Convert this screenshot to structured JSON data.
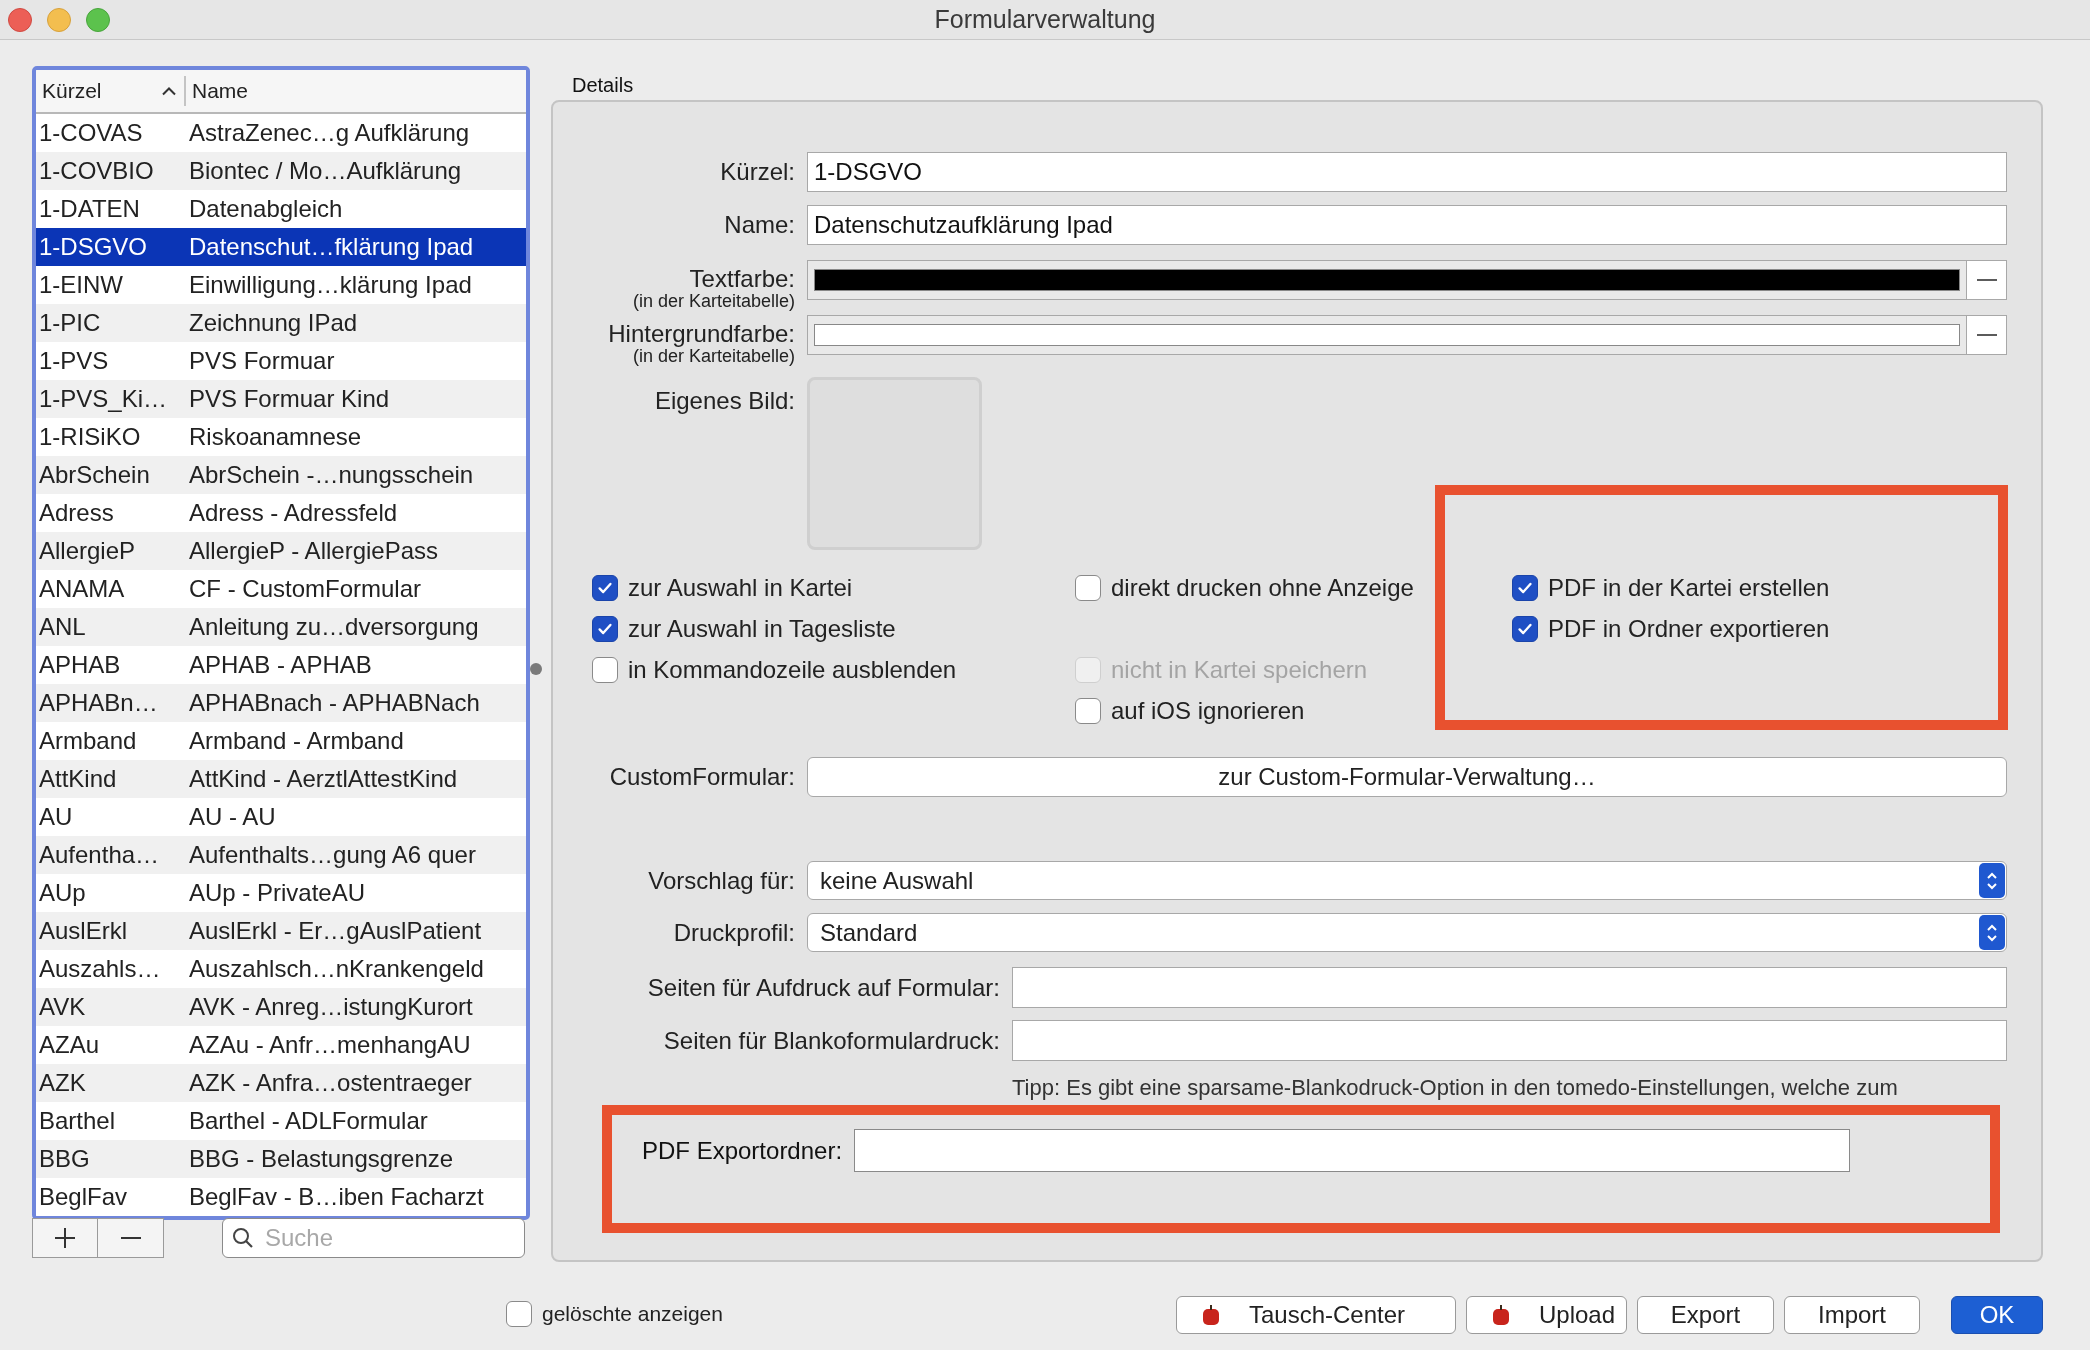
{
  "window": {
    "title": "Formularverwaltung"
  },
  "list": {
    "columns": [
      {
        "label": "Kürzel",
        "sorted": true
      },
      {
        "label": "Name",
        "sorted": false
      }
    ],
    "rows": [
      {
        "kuerzel": "1-COVAS",
        "name": "AstraZenec…g Aufklärung",
        "selected": false
      },
      {
        "kuerzel": "1-COVBIO",
        "name": "Biontec / Mo…Aufklärung",
        "selected": false
      },
      {
        "kuerzel": "1-DATEN",
        "name": "Datenabgleich",
        "selected": false
      },
      {
        "kuerzel": "1-DSGVO",
        "name": "Datenschut…fklärung Ipad",
        "selected": true
      },
      {
        "kuerzel": "1-EINW",
        "name": "Einwilligung…klärung  Ipad",
        "selected": false
      },
      {
        "kuerzel": "1-PIC",
        "name": "Zeichnung IPad",
        "selected": false
      },
      {
        "kuerzel": "1-PVS",
        "name": "PVS Formuar",
        "selected": false
      },
      {
        "kuerzel": "1-PVS_Ki…",
        "name": "PVS Formuar Kind",
        "selected": false
      },
      {
        "kuerzel": "1-RISiKO",
        "name": "Riskoanamnese",
        "selected": false
      },
      {
        "kuerzel": "AbrSchein",
        "name": "AbrSchein -…nungsschein",
        "selected": false
      },
      {
        "kuerzel": "Adress",
        "name": "Adress - Adressfeld",
        "selected": false
      },
      {
        "kuerzel": "AllergieP",
        "name": "AllergieP - AllergiePass",
        "selected": false
      },
      {
        "kuerzel": "ANAMA",
        "name": "CF - CustomFormular",
        "selected": false
      },
      {
        "kuerzel": "ANL",
        "name": "Anleitung zu…dversorgung",
        "selected": false
      },
      {
        "kuerzel": "APHAB",
        "name": "APHAB - APHAB",
        "selected": false
      },
      {
        "kuerzel": "APHABn…",
        "name": "APHABnach - APHABNach",
        "selected": false
      },
      {
        "kuerzel": "Armband",
        "name": "Armband - Armband",
        "selected": false
      },
      {
        "kuerzel": "AttKind",
        "name": "AttKind - AerztlAttestKind",
        "selected": false
      },
      {
        "kuerzel": "AU",
        "name": "AU - AU",
        "selected": false
      },
      {
        "kuerzel": "Aufentha…",
        "name": "Aufenthalts…gung A6 quer",
        "selected": false
      },
      {
        "kuerzel": "AUp",
        "name": "AUp - PrivateAU",
        "selected": false
      },
      {
        "kuerzel": "AuslErkl",
        "name": "AuslErkl - Er…gAuslPatient",
        "selected": false
      },
      {
        "kuerzel": "Auszahls…",
        "name": "Auszahlsch…nKrankengeld",
        "selected": false
      },
      {
        "kuerzel": "AVK",
        "name": "AVK - Anreg…istungKurort",
        "selected": false
      },
      {
        "kuerzel": "AZAu",
        "name": "AZAu - Anfr…menhangAU",
        "selected": false
      },
      {
        "kuerzel": "AZK",
        "name": "AZK - Anfra…ostentraeger",
        "selected": false
      },
      {
        "kuerzel": "Barthel",
        "name": "Barthel - ADLFormular",
        "selected": false
      },
      {
        "kuerzel": "BBG",
        "name": "BBG - Belastungsgrenze",
        "selected": false
      },
      {
        "kuerzel": "BeglFav",
        "name": "BeglFav - B…iben Facharzt",
        "selected": false
      }
    ]
  },
  "search": {
    "placeholder": "Suche"
  },
  "details": {
    "title": "Details",
    "fields": [
      {
        "label": "Kürzel:",
        "value": "1-DSGVO"
      },
      {
        "label": "Name:",
        "value": "Datenschutzaufklärung Ipad"
      }
    ],
    "colors": [
      {
        "label": "Textfarbe:",
        "sublabel": "(in der Karteitabelle)",
        "color": "#000000"
      },
      {
        "label": "Hintergrundfarbe:",
        "sublabel": "(in der Karteitabelle)",
        "color": "#ffffff"
      }
    ],
    "image_label": "Eigenes Bild:",
    "option_columns": [
      {
        "options": [
          {
            "label": "zur Auswahl in Kartei",
            "checked": true,
            "disabled": false
          },
          {
            "label": "zur Auswahl in Tagesliste",
            "checked": true,
            "disabled": false
          },
          {
            "label": "in Kommandozeile ausblenden",
            "checked": false,
            "disabled": false
          }
        ]
      },
      {
        "options": [
          {
            "label": "direkt drucken ohne Anzeige",
            "checked": false,
            "disabled": false
          },
          {
            "label": "nicht in Kartei speichern",
            "checked": false,
            "disabled": true
          },
          {
            "label": "auf iOS ignorieren",
            "checked": false,
            "disabled": false
          }
        ]
      },
      {
        "options": [
          {
            "label": "PDF in der Kartei erstellen",
            "checked": true,
            "disabled": false
          },
          {
            "label": "PDF in Ordner exportieren",
            "checked": true,
            "disabled": false
          }
        ]
      }
    ],
    "custom_form": {
      "label": "CustomFormular:",
      "button": "zur Custom-Formular-Verwaltung…"
    },
    "selects": [
      {
        "label": "Vorschlag für:",
        "value": "keine Auswahl"
      },
      {
        "label": "Druckprofil:",
        "value": "Standard"
      }
    ],
    "pages": [
      {
        "label": "Seiten für Aufdruck auf Formular:"
      },
      {
        "label": "Seiten für Blankoformulardruck:"
      }
    ],
    "tip": "Tipp: Es gibt eine sparsame-Blankodruck-Option in den tomedo-Einstellungen, welche zum",
    "export_folder": {
      "label": "PDF Exportordner:"
    }
  },
  "show_deleted": {
    "label": "gelöschte anzeigen",
    "checked": false
  },
  "buttons": [
    {
      "label": "Tausch-Center",
      "kind": "icon"
    },
    {
      "label": "Upload",
      "kind": "icon"
    },
    {
      "label": "Export",
      "kind": "plain"
    },
    {
      "label": "Import",
      "kind": "plain"
    },
    {
      "label": "OK",
      "kind": "default"
    }
  ]
}
